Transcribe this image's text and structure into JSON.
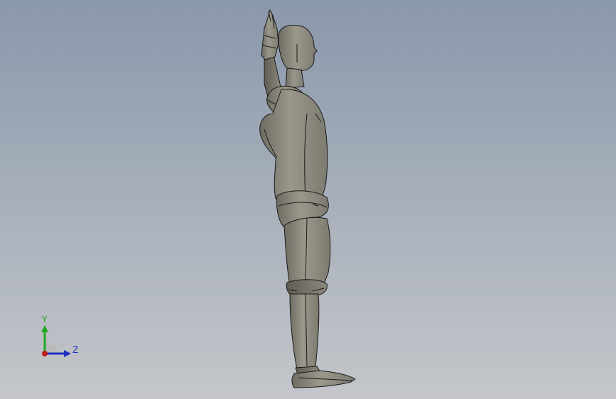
{
  "viewport": {
    "background_top": "#8a98ab",
    "background_bottom": "#c4c6ca"
  },
  "model": {
    "icon": "human-mannequin-side-view",
    "surface_color": "#8f8d80",
    "edge_color": "#1a1a1a"
  },
  "triad": {
    "y_label": "Y",
    "z_label": "Z",
    "y_color": "#1fa81f",
    "z_color": "#1f2fbf",
    "x_color": "#c41a1a"
  }
}
